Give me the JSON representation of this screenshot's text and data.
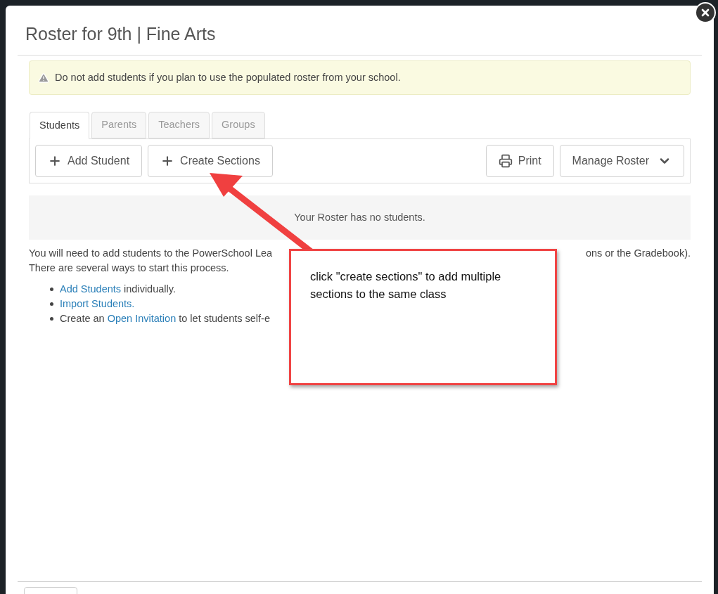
{
  "dialog": {
    "title": "Roster for 9th | Fine Arts"
  },
  "alert": {
    "text": "Do not add students if you plan to use the populated roster from your school."
  },
  "tabs": [
    {
      "label": "Students",
      "selected": true
    },
    {
      "label": "Parents",
      "selected": false
    },
    {
      "label": "Teachers",
      "selected": false
    },
    {
      "label": "Groups",
      "selected": false
    }
  ],
  "toolbar": {
    "left": [
      {
        "label": "Add Student",
        "kind": "add"
      },
      {
        "label": "Create Sections",
        "kind": "add"
      }
    ],
    "right": [
      {
        "label": "Print",
        "kind": "print"
      },
      {
        "label": "Manage Roster",
        "kind": "menu"
      }
    ]
  },
  "empty_message": "Your Roster has no students.",
  "intro": {
    "line_1_start": "You will need to add students to the PowerSchool Lea",
    "line_1_end": "ons or the Gradebook).",
    "line_2": "There are several ways to start this process."
  },
  "options": [
    {
      "parts": [
        {
          "kind": "link",
          "text": "Add Students"
        },
        {
          "kind": "text",
          "text": "individually."
        }
      ]
    },
    {
      "parts": [
        {
          "kind": "link",
          "text": "Import Students."
        }
      ]
    },
    {
      "parts": [
        {
          "kind": "text",
          "text": "Create an"
        },
        {
          "kind": "link",
          "text": "Open Invitation"
        },
        {
          "kind": "text",
          "text": "to let students self-e"
        }
      ]
    }
  ],
  "callout": {
    "text": "click \"create sections\" to add multiple sections to the same class"
  }
}
